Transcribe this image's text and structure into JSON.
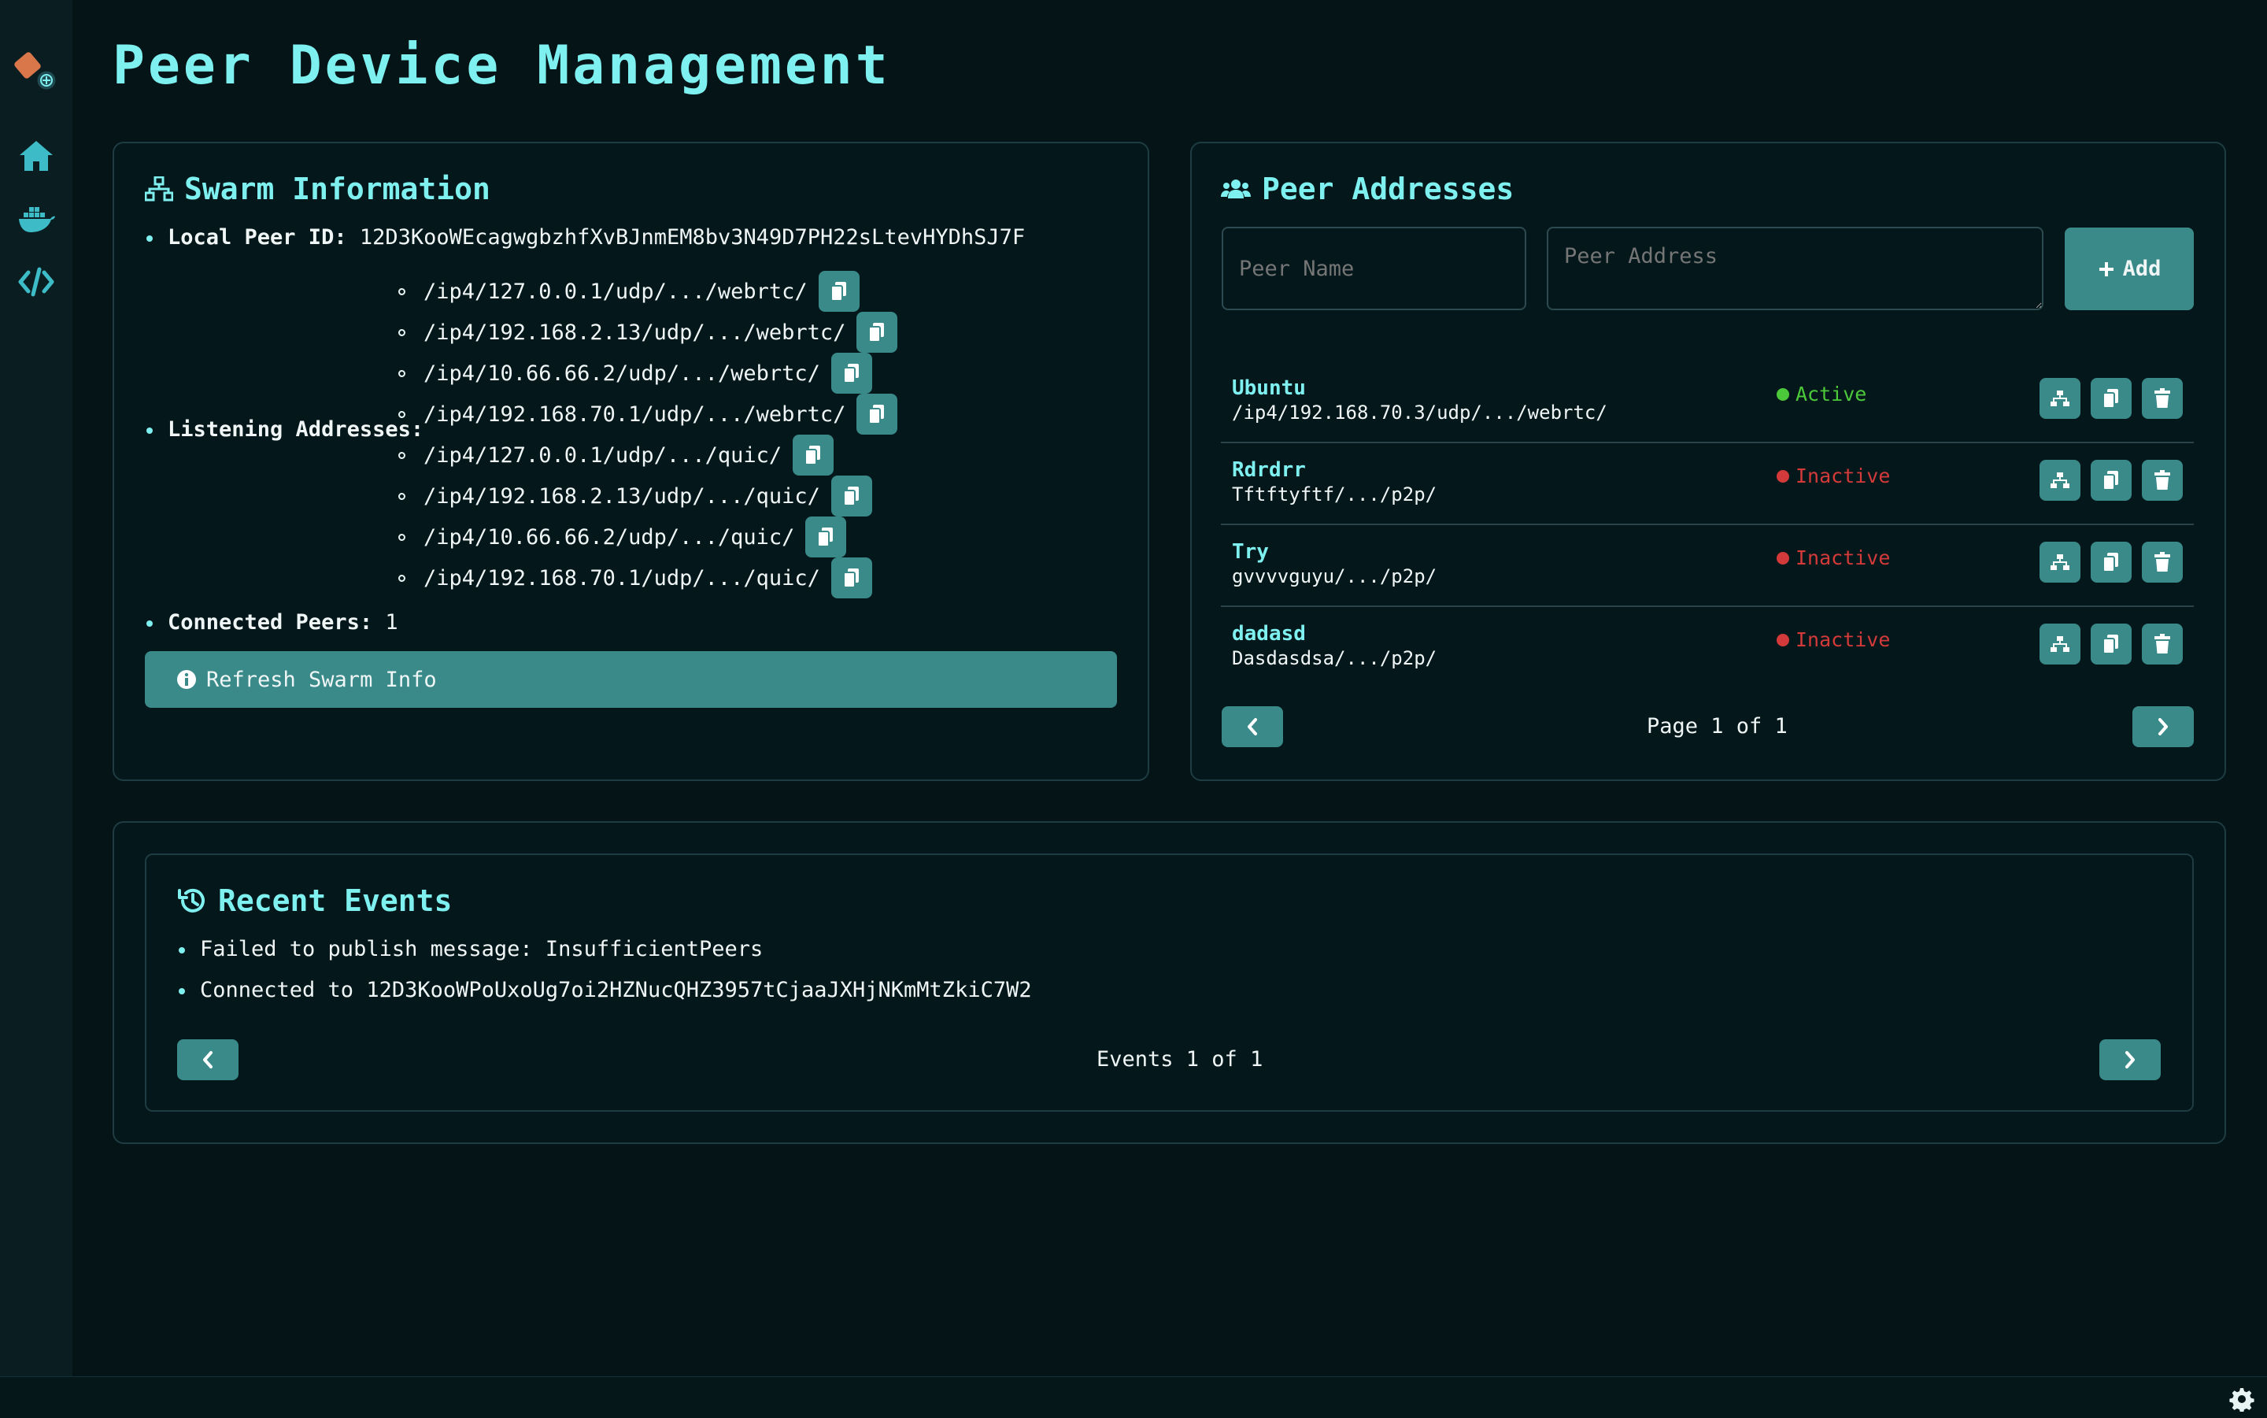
{
  "page": {
    "title": "Peer Device Management"
  },
  "sidebar": {
    "items": [
      {
        "icon": "home-icon"
      },
      {
        "icon": "docker-icon"
      },
      {
        "icon": "code-icon"
      }
    ]
  },
  "swarm": {
    "title": "Swarm Information",
    "local_peer_label": "Local Peer ID:",
    "local_peer_id": "12D3KooWEcagwgbzhfXvBJnmEM8bv3N49D7PH22sLtevHYDhSJ7F",
    "listening_label": "Listening Addresses:",
    "addresses": [
      "/ip4/127.0.0.1/udp/.../webrtc/",
      "/ip4/192.168.2.13/udp/.../webrtc/",
      "/ip4/10.66.66.2/udp/.../webrtc/",
      "/ip4/192.168.70.1/udp/.../webrtc/",
      "/ip4/127.0.0.1/udp/.../quic/",
      "/ip4/192.168.2.13/udp/.../quic/",
      "/ip4/10.66.66.2/udp/.../quic/",
      "/ip4/192.168.70.1/udp/.../quic/"
    ],
    "connected_label": "Connected Peers:",
    "connected_count": "1",
    "refresh_label": "Refresh Swarm Info"
  },
  "peers": {
    "title": "Peer Addresses",
    "name_placeholder": "Peer Name",
    "address_placeholder": "Peer Address",
    "add_label": "Add",
    "rows": [
      {
        "name": "Ubuntu",
        "address": "/ip4/192.168.70.3/udp/.../webrtc/",
        "status": "Active"
      },
      {
        "name": "Rdrdrr",
        "address": "Tftftyftf/.../p2p/",
        "status": "Inactive"
      },
      {
        "name": "Try",
        "address": "gvvvvguyu/.../p2p/",
        "status": "Inactive"
      },
      {
        "name": "dadasd",
        "address": "Dasdasdsa/.../p2p/",
        "status": "Inactive"
      }
    ],
    "page_text": "Page 1 of 1"
  },
  "events": {
    "title": "Recent Events",
    "items": [
      "Failed to publish message: InsufficientPeers",
      "Connected to 12D3KooWPoUxoUg7oi2HZNucQHZ3957tCjaaJXHjNKmMtZkiC7W2"
    ],
    "page_text": "Events 1 of 1"
  },
  "colors": {
    "accent": "#7ff0f0",
    "button": "#3a8a8a",
    "active": "#4cc93a",
    "inactive": "#d43a3a",
    "background": "#041417"
  }
}
